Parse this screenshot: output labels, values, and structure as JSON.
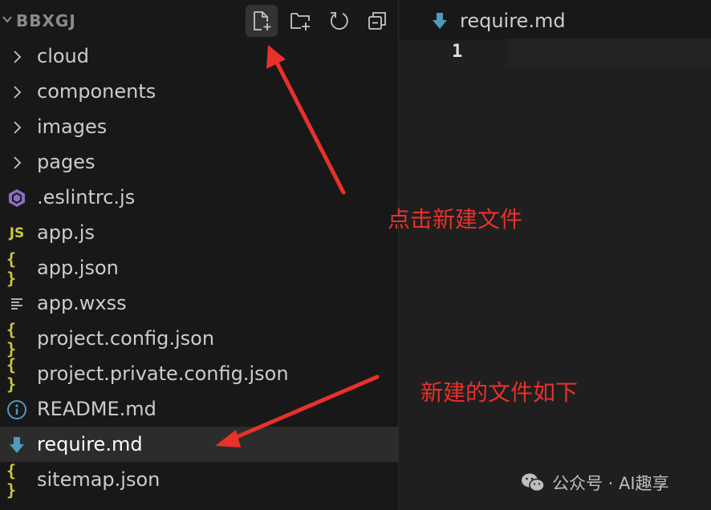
{
  "explorer": {
    "root": "BBXGJ",
    "items": [
      {
        "label": "cloud",
        "kind": "folder",
        "icon": "chevron-right-icon"
      },
      {
        "label": "components",
        "kind": "folder",
        "icon": "chevron-right-icon"
      },
      {
        "label": "images",
        "kind": "folder",
        "icon": "chevron-right-icon"
      },
      {
        "label": "pages",
        "kind": "folder",
        "icon": "chevron-right-icon"
      },
      {
        "label": ".eslintrc.js",
        "kind": "file",
        "icon": "eslint-icon"
      },
      {
        "label": "app.js",
        "kind": "file",
        "icon": "javascript-icon",
        "badge": "JS"
      },
      {
        "label": "app.json",
        "kind": "file",
        "icon": "json-icon",
        "badge": "{ }"
      },
      {
        "label": "app.wxss",
        "kind": "file",
        "icon": "lines-icon"
      },
      {
        "label": "project.config.json",
        "kind": "file",
        "icon": "json-icon",
        "badge": "{ }"
      },
      {
        "label": "project.private.config.json",
        "kind": "file",
        "icon": "json-icon",
        "badge": "{ }"
      },
      {
        "label": "README.md",
        "kind": "file",
        "icon": "info-icon"
      },
      {
        "label": "require.md",
        "kind": "file",
        "icon": "markdown-arrow-icon",
        "selected": true
      },
      {
        "label": "sitemap.json",
        "kind": "file",
        "icon": "json-icon",
        "badge": "{ }"
      }
    ],
    "toolbar": [
      "new-file-icon",
      "new-folder-icon",
      "refresh-icon",
      "collapse-all-icon"
    ]
  },
  "editor": {
    "tab_label": "require.md",
    "line_number": "1"
  },
  "annotations": {
    "click_new_file": "点击新建文件",
    "new_file_created": "新建的文件如下"
  },
  "watermark": {
    "text": "公众号 · AI趣享"
  },
  "colors": {
    "background": "#181818",
    "editor_background": "#1f1f1f",
    "selected_row": "#2c2c2c",
    "annotation_red": "#e8312b",
    "json_yellow": "#cbcb41",
    "markdown_blue": "#519aba",
    "eslint_purple": "#8c6dc4"
  }
}
